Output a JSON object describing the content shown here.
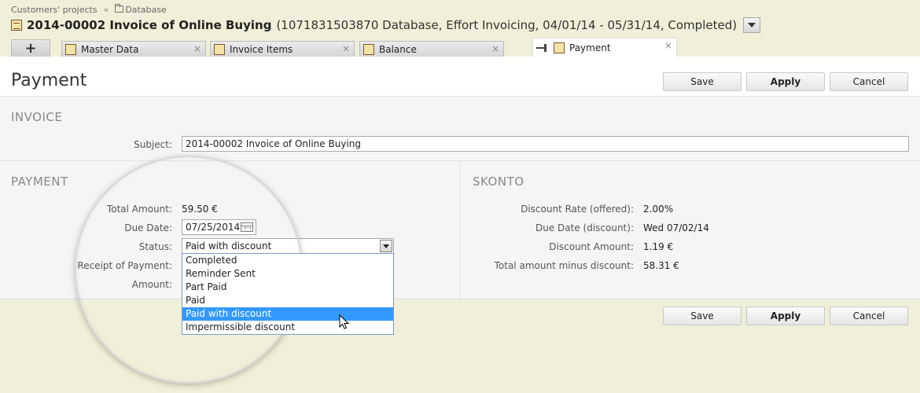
{
  "breadcrumb": {
    "root": "Customers' projects",
    "separator": "»",
    "current": "Database"
  },
  "header": {
    "title": "2014-00002 Invoice of Online Buying",
    "subtitle": "(1071831503870 Database, Effort Invoicing, 04/01/14 - 05/31/14, Completed)"
  },
  "tabs": [
    {
      "label": "Master Data",
      "close": "×"
    },
    {
      "label": "Invoice Items",
      "close": "×"
    },
    {
      "label": "Balance",
      "close": "×"
    },
    {
      "label": "Payment",
      "close": "×",
      "active": true
    }
  ],
  "tab_add_label": "+",
  "page": {
    "title": "Payment"
  },
  "toolbar": {
    "save_label": "Save",
    "apply_label": "Apply",
    "cancel_label": "Cancel"
  },
  "invoice_section": {
    "title": "INVOICE",
    "subject_label": "Subject:",
    "subject_value": "2014-00002 Invoice of Online Buying"
  },
  "payment_section": {
    "title": "PAYMENT",
    "total_amount_label": "Total Amount:",
    "total_amount_value": "59.50 €",
    "due_date_label": "Due Date:",
    "due_date_value": "07/25/2014",
    "status_label": "Status:",
    "status_value": "Paid with discount",
    "receipt_label": "Receipt of Payment:",
    "amount_label": "Amount:",
    "status_options": [
      "Completed",
      "Reminder Sent",
      "Part Paid",
      "Paid",
      "Paid with discount",
      "Impermissible discount"
    ],
    "highlighted_option": "Paid with discount"
  },
  "skonto_section": {
    "title": "SKONTO",
    "rows": [
      {
        "label": "Discount Rate (offered):",
        "value": "2.00%"
      },
      {
        "label": "Due Date (discount):",
        "value": "Wed 07/02/14"
      },
      {
        "label": "Discount Amount:",
        "value": "1.19 €"
      },
      {
        "label": "Total amount minus discount:",
        "value": "58.31 €"
      }
    ]
  },
  "colors": {
    "header_bg": "#f0efd9",
    "selection": "#3399ff",
    "section_bg": "#f5f5f5"
  }
}
